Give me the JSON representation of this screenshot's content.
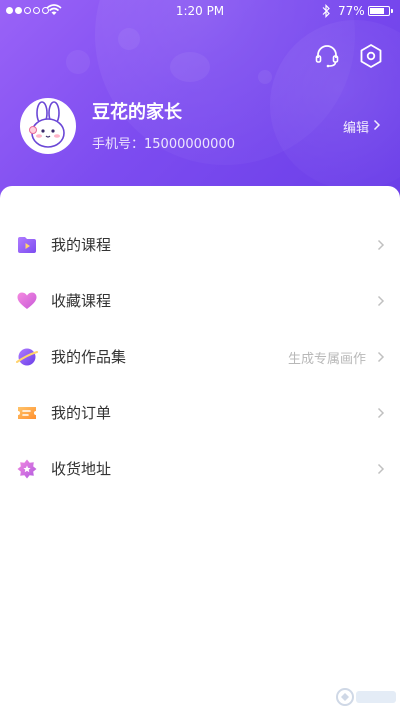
{
  "status_bar": {
    "time": "1:20 PM",
    "battery": "77%",
    "battery_level": 0.77
  },
  "profile": {
    "name": "豆花的家长",
    "phone": "手机号：15000000000",
    "edit_label": "编辑"
  },
  "menu": [
    {
      "label": "我的课程",
      "hint": "",
      "icon": "video-folder-icon"
    },
    {
      "label": "收藏课程",
      "hint": "",
      "icon": "heart-icon"
    },
    {
      "label": "我的作品集",
      "hint": "生成专属画作",
      "icon": "planet-icon"
    },
    {
      "label": "我的订单",
      "hint": "",
      "icon": "ticket-icon"
    },
    {
      "label": "收货地址",
      "hint": "",
      "icon": "star-badge-icon"
    }
  ],
  "colors": {
    "header_start": "#9a63f7",
    "header_end": "#6a3ee8",
    "icon_purple": "#8a5cf5",
    "icon_pink": "#e86bd6",
    "icon_orange": "#ffa94d"
  }
}
